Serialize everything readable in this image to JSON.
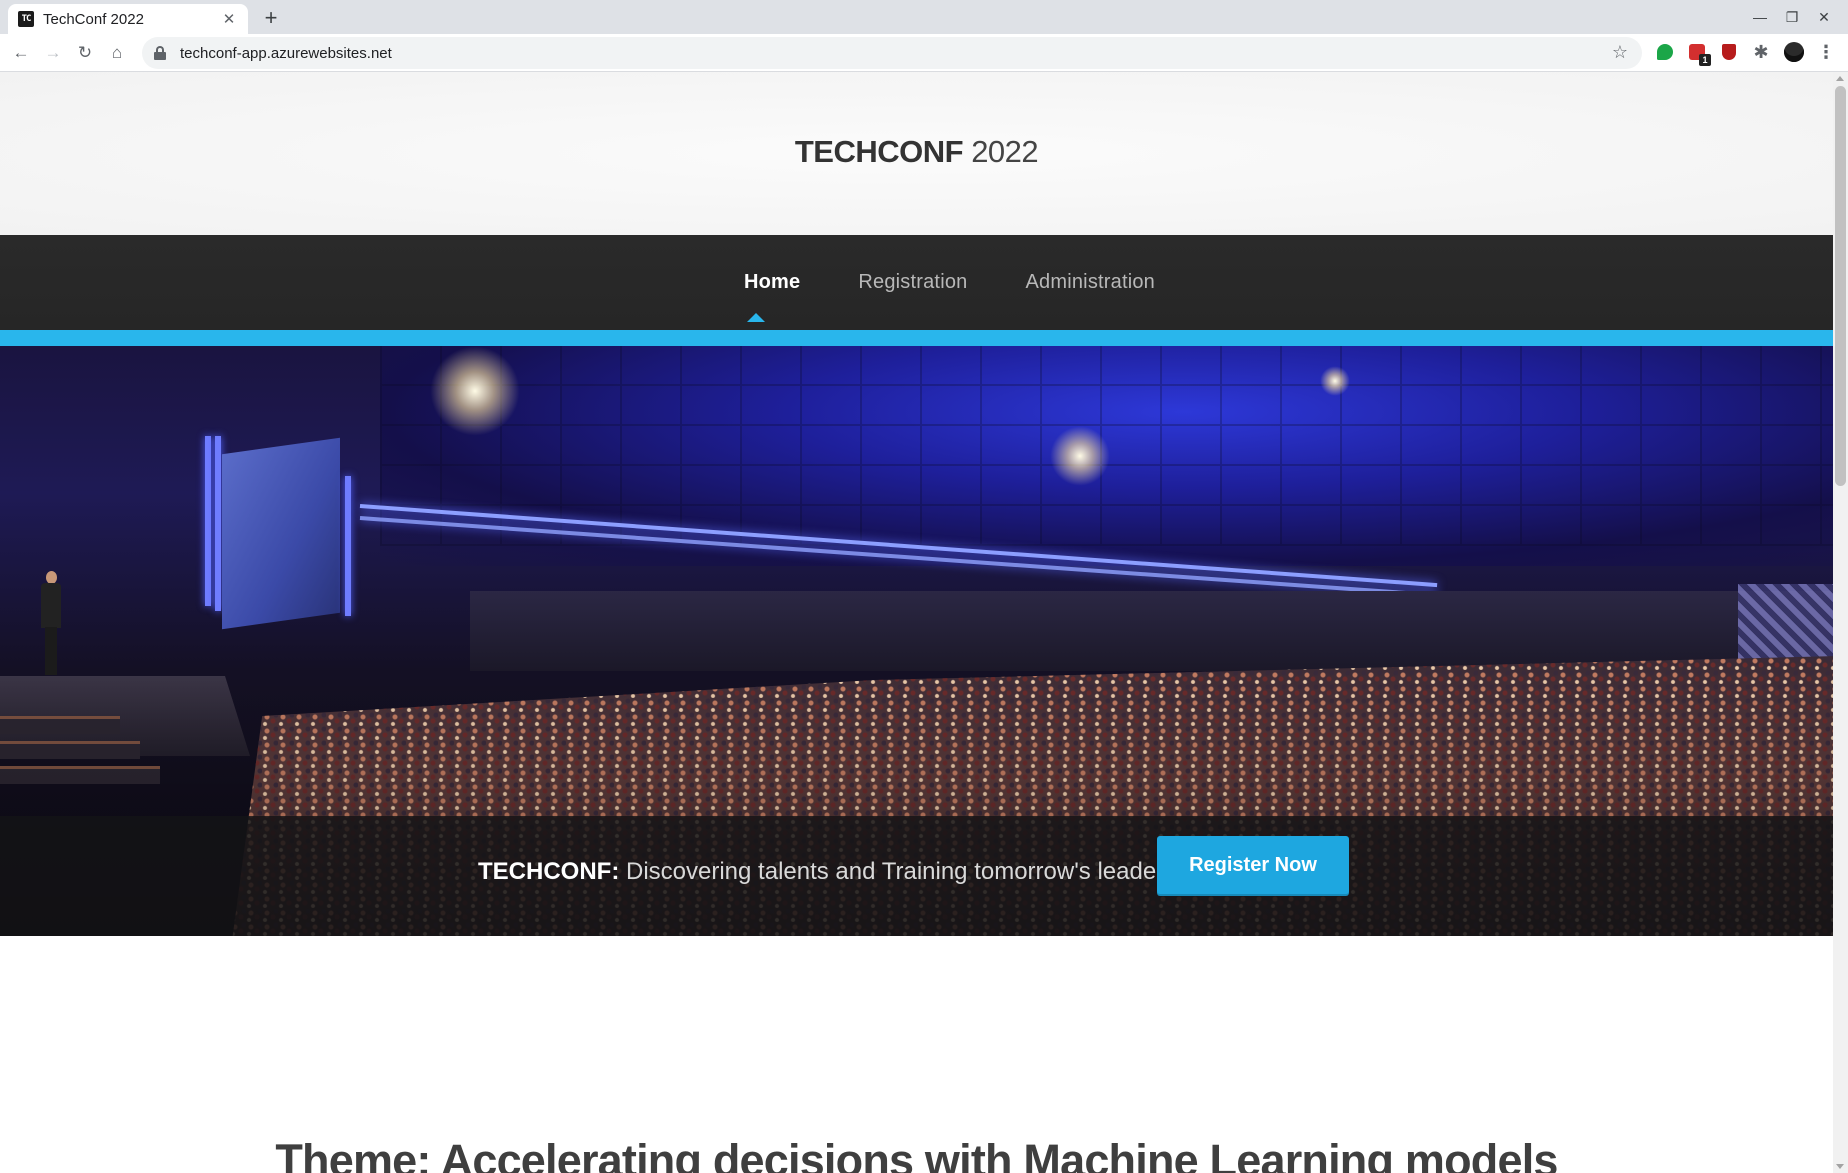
{
  "browser": {
    "tab_title": "TechConf 2022",
    "favicon_text": "TC",
    "new_tab": "+",
    "close_tab": "✕",
    "url": "techconf-app.azurewebsites.net",
    "extension_badge": "1",
    "controls": {
      "minimize": "—",
      "restore": "❐",
      "close": "✕"
    },
    "nav": {
      "back": "←",
      "forward": "→",
      "reload": "↻",
      "home": "⌂"
    },
    "star": "☆",
    "menu": "⋮"
  },
  "site": {
    "brand_bold": "TECHCONF",
    "brand_light": "2022",
    "nav": [
      {
        "label": "Home",
        "active": true
      },
      {
        "label": "Registration",
        "active": false
      },
      {
        "label": "Administration",
        "active": false
      }
    ],
    "accent_color": "#29b6ec",
    "hero": {
      "tagline_bold": "TECHCONF:",
      "tagline_text": "Discovering talents and Training tomorrow's leaders",
      "cta_label": "Register Now",
      "cta_color": "#1ea7e0"
    },
    "theme": {
      "label": "Theme",
      "separator": ":",
      "text": "Accelerating decisions with Machine Learning models"
    }
  }
}
